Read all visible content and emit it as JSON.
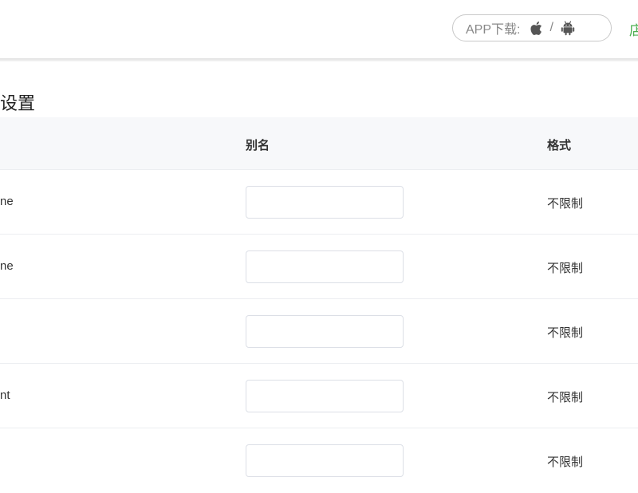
{
  "header": {
    "app_download_label": "APP下载:",
    "separator": "/",
    "apple_icon": "apple-icon",
    "android_icon": "android-icon",
    "right_partial_text": "店",
    "right_partial_color": "#4caf50"
  },
  "page": {
    "section_title": "设置"
  },
  "table": {
    "columns": {
      "alias": "别名",
      "format": "格式"
    },
    "rows": [
      {
        "name": "ne",
        "alias_value": "",
        "format": "不限制"
      },
      {
        "name": "ne",
        "alias_value": "",
        "format": "不限制"
      },
      {
        "name": "",
        "alias_value": "",
        "format": "不限制"
      },
      {
        "name": "nt",
        "alias_value": "",
        "format": "不限制"
      },
      {
        "name": "",
        "alias_value": "",
        "format": "不限制"
      }
    ]
  }
}
